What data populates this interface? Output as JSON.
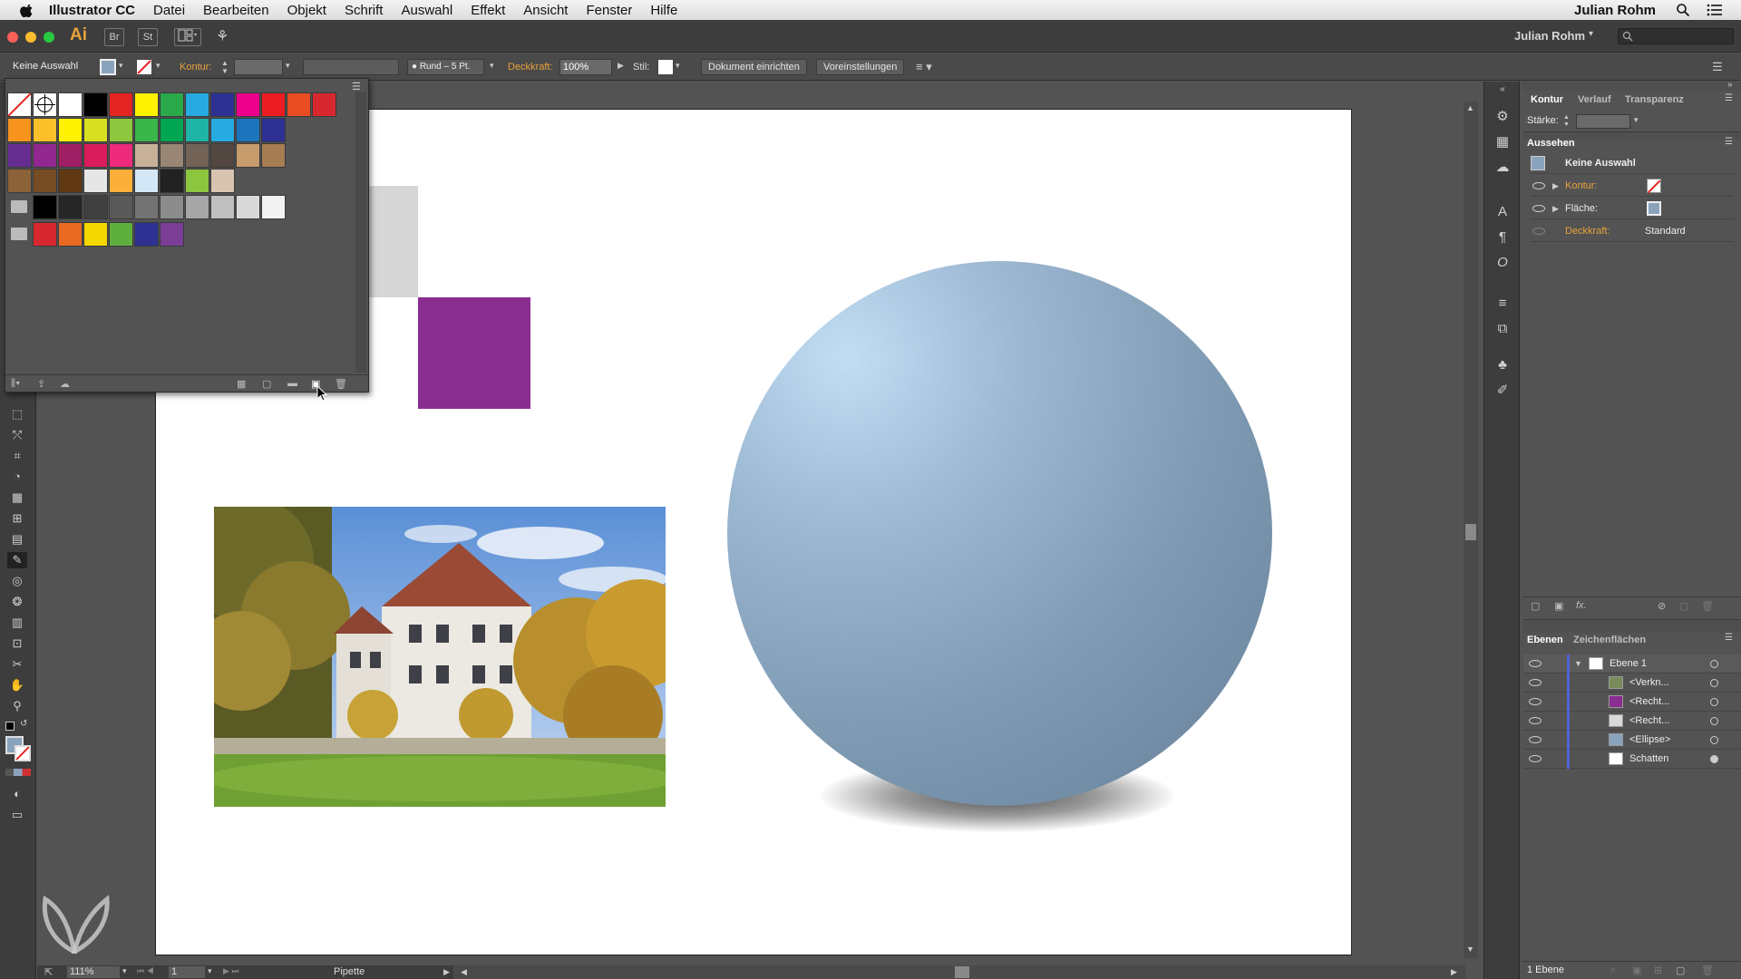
{
  "menubar": {
    "app_name": "Illustrator CC",
    "items": [
      "Datei",
      "Bearbeiten",
      "Objekt",
      "Schrift",
      "Auswahl",
      "Effekt",
      "Ansicht",
      "Fenster",
      "Hilfe"
    ],
    "user": "Julian Rohm"
  },
  "appbar": {
    "logo": "Ai",
    "bridge": "Br",
    "stock": "St",
    "user": "Julian Rohm",
    "search_placeholder": ""
  },
  "control": {
    "selection": "Keine Auswahl",
    "stroke_label": "Kontur:",
    "brush": "Rund – 5 Pt.",
    "opacity_label": "Deckkraft:",
    "opacity_value": "100%",
    "style_label": "Stil:",
    "doc_setup": "Dokument einrichten",
    "preferences": "Voreinstellungen"
  },
  "swatches": {
    "row1": [
      "#ffffff",
      "#000000",
      "#e52521",
      "#fff200",
      "#2aa84a",
      "#27aae1",
      "#2e3192",
      "#ec008c",
      "#ed1c24",
      "#e84c22",
      "#d8282f"
    ],
    "row2": [
      "#f7941d",
      "#f9c02a",
      "#fff200",
      "#d7e022",
      "#8dc63f",
      "#39b54a",
      "#00a651",
      "#1eb4a6",
      "#27aae1",
      "#1c75bc",
      "#2e3192"
    ],
    "row3": [
      "#662d91",
      "#92278f",
      "#9e1f63",
      "#da1c5c",
      "#ed2a7b",
      "#c7b299",
      "#998675",
      "#736357",
      "#534741",
      "#c69c6d",
      "#a67c52"
    ],
    "row4": [
      "#8c6239",
      "#754c24",
      "#603813",
      "#e6e6e6",
      "#fbb03b",
      "#d4e7f7",
      "#222222",
      "#8cc63f",
      "#d8c4b0"
    ],
    "grays": [
      "#000000",
      "#262626",
      "#404040",
      "#595959",
      "#737373",
      "#8c8c8c",
      "#a6a6a6",
      "#bfbfbf",
      "#d9d9d9",
      "#f2f2f2"
    ],
    "group2": [
      "#d8282f",
      "#e86a22",
      "#f4d800",
      "#5faf3f",
      "#2e3192",
      "#7a3f95"
    ]
  },
  "right_panel": {
    "tabs": [
      "Kontur",
      "Verlauf",
      "Transparenz"
    ],
    "weight_label": "Stärke:",
    "appearance_title": "Aussehen",
    "no_selection": "Keine Auswahl",
    "stroke": "Kontur:",
    "fill": "Fläche:",
    "opacity": "Deckkraft:",
    "opacity_value": "Standard",
    "fx": "fx."
  },
  "layers": {
    "tabs": [
      "Ebenen",
      "Zeichenflächen"
    ],
    "items": [
      {
        "name": "Ebene 1",
        "thumb": "#ffffff"
      },
      {
        "name": "<Verkn...",
        "thumb": "#7a8a5a"
      },
      {
        "name": "<Recht...",
        "thumb": "#8a2d91"
      },
      {
        "name": "<Recht...",
        "thumb": "#d9d9d9"
      },
      {
        "name": "<Ellipse>",
        "thumb": "#8aa3bd"
      },
      {
        "name": "Schatten",
        "thumb": "#ffffff"
      }
    ],
    "footer": "1 Ebene"
  },
  "status": {
    "zoom": "111%",
    "page": "1",
    "tool": "Pipette"
  },
  "colors": {
    "purple_rect": "#8a2d91",
    "gray_rect": "#d6d6d6",
    "accent_orange": "#e8a23a"
  },
  "icons": [
    "apple-icon",
    "search-icon",
    "menu-list-icon",
    "eyedropper-icon",
    "hand-icon",
    "zoom-icon",
    "eye-icon",
    "folder-icon",
    "trash-icon"
  ]
}
